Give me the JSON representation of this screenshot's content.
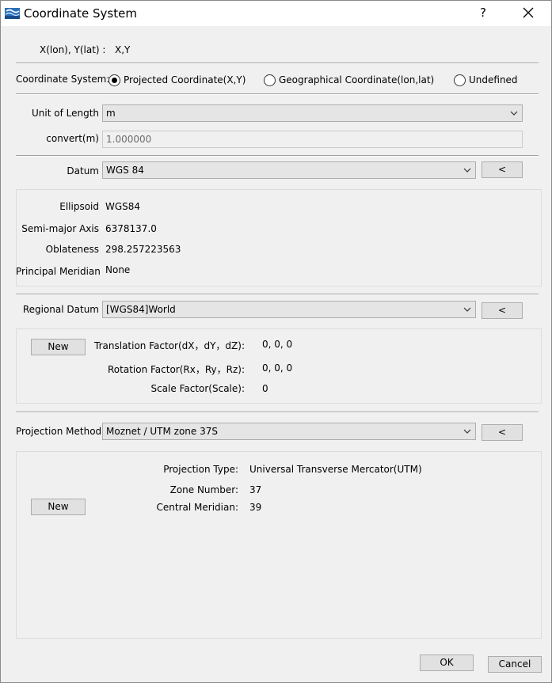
{
  "window": {
    "title": "Coordinate System",
    "help_label": "?"
  },
  "coord_label": {
    "key": "X(lon), Y(lat) :",
    "value": "X,Y"
  },
  "coordinate_system": {
    "label": "Coordinate System:",
    "options": [
      "Projected Coordinate(X,Y)",
      "Geographical Coordinate(lon,lat)",
      "Undefined"
    ],
    "selected": "Projected Coordinate(X,Y)"
  },
  "unit": {
    "label": "Unit of Length",
    "value": "m",
    "convert_label": "convert(m)",
    "convert_value": "1.000000"
  },
  "datum": {
    "label": "Datum",
    "value": "WGS 84",
    "back_label": "<",
    "ellipsoid_label": "Ellipsoid",
    "ellipsoid_value": "WGS84",
    "semi_major_label": "Semi-major Axis",
    "semi_major_value": "6378137.0",
    "oblateness_label": "Oblateness",
    "oblateness_value": "298.257223563",
    "principal_label": "Principal Meridian",
    "principal_value": "None"
  },
  "regional_datum": {
    "label": "Regional Datum",
    "value": "[WGS84]World",
    "back_label": "<",
    "new_label": "New",
    "translation_label": "Translation Factor(dX，dY，dZ):",
    "translation_value": "0, 0, 0",
    "rotation_label": "Rotation Factor(Rx，Ry，Rz):",
    "rotation_value": "0, 0, 0",
    "scale_label": "Scale Factor(Scale):",
    "scale_value": "0"
  },
  "projection": {
    "label": "Projection Method",
    "value": "Moznet / UTM zone 37S",
    "back_label": "<",
    "new_label": "New",
    "type_label": "Projection Type:",
    "type_value": "Universal Transverse Mercator(UTM)",
    "zone_label": "Zone Number:",
    "zone_value": "37",
    "meridian_label": "Central Meridian:",
    "meridian_value": "39"
  },
  "footer": {
    "ok_label": "OK",
    "cancel_label": "Cancel"
  }
}
